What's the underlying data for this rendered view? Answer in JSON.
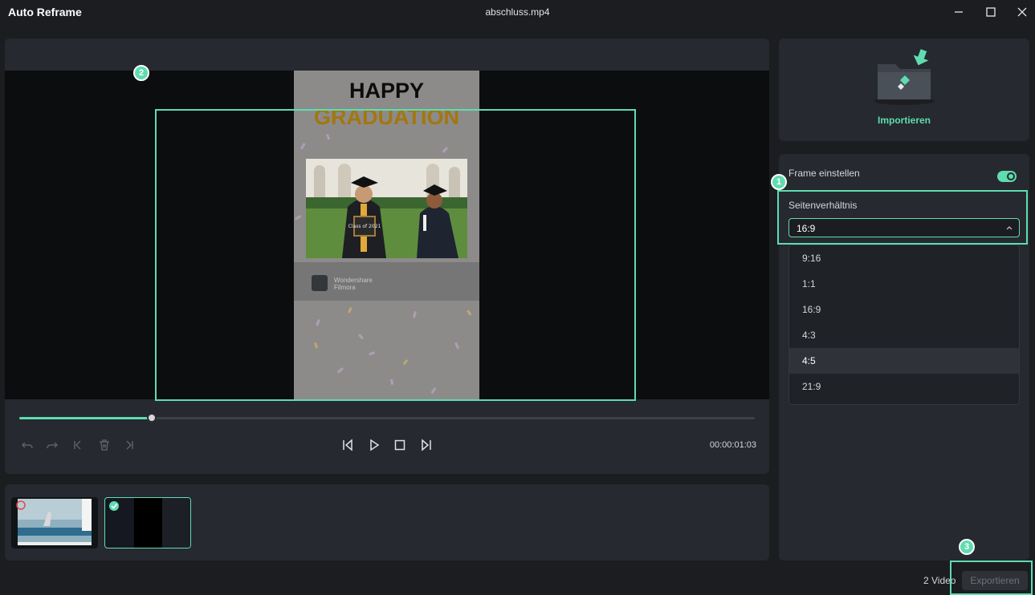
{
  "window": {
    "app_title": "Auto Reframe",
    "file_title": "abschluss.mp4"
  },
  "preview": {
    "poster_line1": "HAPPY",
    "poster_line2": "GRADUATION",
    "brand_line1": "Wondershare",
    "brand_line2": "Filmora",
    "sign_text": "Class of 2021",
    "marker": "2"
  },
  "playback": {
    "progress": 0.18,
    "timecode": "00:00:01:03"
  },
  "import": {
    "label": "Importieren"
  },
  "settings": {
    "frame_label": "Frame einstellen",
    "frame_enabled": true,
    "marker": "1",
    "aspect_label": "Seitenverhältnis",
    "selected_ratio": "16:9",
    "ratio_options": [
      "9:16",
      "1:1",
      "16:9",
      "4:3",
      "4:5",
      "21:9"
    ],
    "hovered_option": "4:5"
  },
  "footer": {
    "video_count": "2 Video",
    "export_label": "Exportieren",
    "marker": "3"
  },
  "colors": {
    "accent": "#5fdcb0",
    "background": "#1b1d21",
    "panel": "#26292f"
  }
}
